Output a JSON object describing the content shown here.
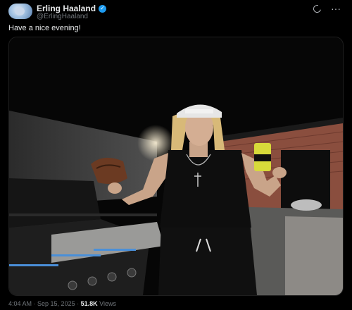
{
  "author": {
    "name": "Erling Haaland",
    "handle": "@ErlingHaaland",
    "verified_icon": "verified-badge-icon"
  },
  "header_icons": [
    "grok-icon",
    "more-icon"
  ],
  "tweet": {
    "text": "Have a nice evening!",
    "media_icon": "photo-of-man-holding-steak-and-drink-can-by-grill"
  },
  "meta": {
    "time": "4:04 AM",
    "sep1": " · ",
    "date": "Sep 15, 2025",
    "sep2": " · ",
    "views_count": "51.8K",
    "views_label": " Views"
  },
  "colors": {
    "background": "#000000",
    "text": "#e7e9ea",
    "secondary": "#71767b",
    "verified": "#1d9bf0"
  }
}
